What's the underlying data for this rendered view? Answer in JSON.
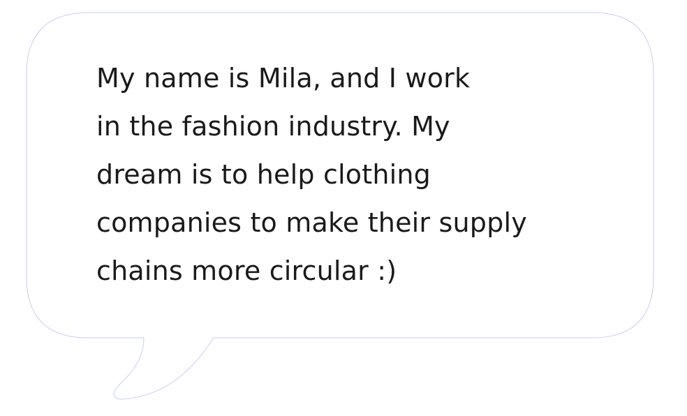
{
  "bubble": {
    "lines": [
      "My name is Mila, and I work",
      "in the fashion industry. My",
      "dream is to help clothing",
      "companies to make their supply",
      "chains more circular :)"
    ]
  },
  "colors": {
    "background": "#ffffff",
    "bubble_fill": "#ffffff",
    "bubble_outline": "#c9cdf0",
    "text": "#1a1a1a"
  }
}
